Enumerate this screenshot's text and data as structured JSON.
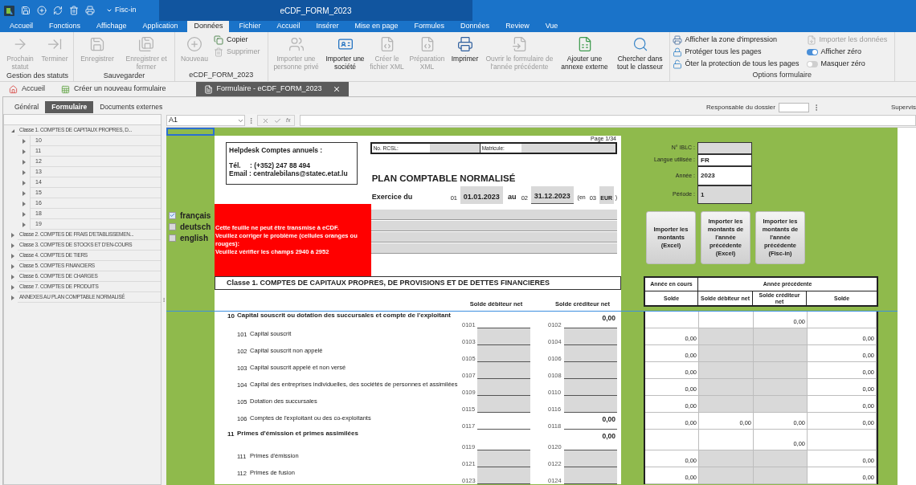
{
  "quick_access": {
    "menu_label": "Fisc-in"
  },
  "window": {
    "title": "eCDF_FORM_2023"
  },
  "ribbon_tabs": [
    {
      "label": "Accueil",
      "selected": false
    },
    {
      "label": "Fonctions",
      "selected": false
    },
    {
      "label": "Affichage",
      "selected": false
    },
    {
      "label": "Application",
      "selected": false
    },
    {
      "label": "Données",
      "selected": true
    },
    {
      "label": "Fichier",
      "selected": false
    },
    {
      "label": "Accueil",
      "selected": false
    },
    {
      "label": "Insérer",
      "selected": false
    },
    {
      "label": "Mise en page",
      "selected": false
    },
    {
      "label": "Formules",
      "selected": false
    },
    {
      "label": "Données",
      "selected": false
    },
    {
      "label": "Review",
      "selected": false
    },
    {
      "label": "Vue",
      "selected": false
    }
  ],
  "ribbon_groups": [
    {
      "label": "Gestion des statuts",
      "buttons": [
        {
          "kind": "large",
          "label": "Prochain statut",
          "disabled": true
        },
        {
          "kind": "large",
          "label": "Terminer",
          "disabled": true
        }
      ]
    },
    {
      "label": "Sauvegarder",
      "buttons": [
        {
          "kind": "large",
          "label": "Enregistrer",
          "disabled": true
        },
        {
          "kind": "large",
          "label": "Enregistrer et fermer",
          "disabled": true
        }
      ]
    },
    {
      "label": "eCDF_FORM_2023",
      "buttons": [
        {
          "kind": "large",
          "label": "Nouveau",
          "disabled": true
        },
        {
          "kind": "small",
          "label": "Copier",
          "disabled": false
        },
        {
          "kind": "small",
          "label": "Supprimer",
          "disabled": true
        }
      ]
    },
    {
      "buttons": [
        {
          "kind": "large",
          "label": "Importer une personne privé",
          "disabled": true
        },
        {
          "kind": "large",
          "label": "Importer une société",
          "disabled": false
        },
        {
          "kind": "large",
          "label": "Créer le fichier XML",
          "disabled": true
        },
        {
          "kind": "large",
          "label": "Préparation XML",
          "disabled": true
        },
        {
          "kind": "large",
          "label": "Imprimer",
          "disabled": false
        },
        {
          "kind": "large",
          "label": "Ouvrir le formulaire de l'année précédente",
          "disabled": true
        },
        {
          "kind": "large",
          "label": "Ajouter une annexe externe",
          "disabled": false
        },
        {
          "kind": "large",
          "label": "Chercher dans tout le classeur",
          "disabled": false
        }
      ]
    },
    {
      "label": "Options formulaire",
      "buttons": [
        {
          "kind": "small",
          "label": "Afficher la zone d'impression",
          "disabled": false
        },
        {
          "kind": "small",
          "label": "Protéger tous les pages",
          "disabled": false
        },
        {
          "kind": "small",
          "label": "Ôter la protection de tous les pages",
          "disabled": false
        },
        {
          "kind": "small",
          "label": "Importer les données",
          "disabled": true
        },
        {
          "kind": "toggle",
          "label": "Afficher zéro",
          "on": true
        },
        {
          "kind": "toggle",
          "label": "Masquer zéro",
          "on": false
        }
      ]
    }
  ],
  "doc_tabs": [
    {
      "label": "Accueil",
      "selected": false,
      "closable": false
    },
    {
      "label": "Créer un nouveau formulaire",
      "selected": false,
      "closable": false
    },
    {
      "label": "Formulaire - eCDF_FORM_2023",
      "selected": true,
      "closable": true
    }
  ],
  "sub_tabs": [
    {
      "label": "Général",
      "selected": false
    },
    {
      "label": "Formulaire",
      "selected": true
    },
    {
      "label": "Documents externes",
      "selected": false
    }
  ],
  "dossier": {
    "label": "Responsable du dossier",
    "next_label": "Supervis"
  },
  "tree": [
    {
      "label": "Classe 1. COMPTES DE CAPITAUX PROPRES, D...",
      "expanded": true,
      "children": [
        {
          "label": "10",
          "expanded": false
        },
        {
          "label": "11",
          "expanded": false
        },
        {
          "label": "12",
          "expanded": false
        },
        {
          "label": "13",
          "expanded": false
        },
        {
          "label": "14",
          "expanded": false
        },
        {
          "label": "15",
          "expanded": false
        },
        {
          "label": "16",
          "expanded": false
        },
        {
          "label": "18",
          "expanded": false
        },
        {
          "label": "19",
          "expanded": false
        }
      ]
    },
    {
      "label": "Classe 2. COMPTES DE FRAIS D'ETABLISSEMEN...",
      "expanded": false
    },
    {
      "label": "Classe 3. COMPTES DE STOCKS ET D'EN-COURS",
      "expanded": false
    },
    {
      "label": "Classe 4. COMPTES DE TIERS",
      "expanded": false
    },
    {
      "label": "Classe 5. COMPTES FINANCIERS",
      "expanded": false
    },
    {
      "label": "Classe 6. COMPTES DE CHARGES",
      "expanded": false
    },
    {
      "label": "Classe 7. COMPTES DE PRODUITS",
      "expanded": false
    },
    {
      "label": "ANNEXES AU PLAN COMPTABLE NORMALISÉ",
      "expanded": false
    }
  ],
  "formula_bar": {
    "cell": "A1",
    "function_label": "fx"
  },
  "languages": [
    {
      "label": "français",
      "checked": true
    },
    {
      "label": "deutsch",
      "checked": false
    },
    {
      "label": "english",
      "checked": false
    }
  ],
  "form": {
    "page_label": "Page 1/34",
    "helpdesk": {
      "title": "Helpdesk Comptes annuels :",
      "phone_label": "Tél.",
      "phone": ": (+352) 247 88 494",
      "email": "Email : centralebilans@statec.etat.lu"
    },
    "id_labels": [
      "No. RCSL:",
      "Matricule:"
    ],
    "title": "PLAN COMPTABLE NORMALISÉ",
    "exercise": {
      "label": "Exercice du",
      "start_code": "01",
      "start": "01.01.2023",
      "to": "au",
      "end_code": "02",
      "end": "31.12.2023",
      "currency_open": "(en",
      "currency_code": "03",
      "currency": "EUR",
      "currency_close": ")"
    },
    "error_lines": [
      "Cette feuille ne peut être transmise à eCDF.",
      "Veuillez corriger le problème (cellules oranges ou rouges):",
      "Veuillez vérifier les champs 2940 à 2952"
    ],
    "blank_rows": [
      {
        "input": true
      },
      {
        "input": true
      },
      {
        "input": true
      },
      {
        "input": true
      }
    ],
    "section_title": "Classe 1. COMPTES DE CAPITAUX PROPRES, DE PROVISIONS ET DE DETTES FINANCIERES",
    "columns": [
      "Solde débiteur net",
      "Solde créditeur net"
    ]
  },
  "info_fields": [
    {
      "label": "N° IBLC :",
      "input": true
    },
    {
      "label": "Langue utilisée :",
      "value": "FR",
      "input": false
    },
    {
      "label": "Année :",
      "value": "2023",
      "input": false
    },
    {
      "label": "Période :",
      "value": "1",
      "input": true
    }
  ],
  "import_buttons": [
    "Importer les montants (Excel)",
    "Importer les montants de l'année précédente (Excel)",
    "Importer les montants de l'année précédente (Fisc-in)"
  ],
  "table_header": {
    "current": "Année en cours",
    "previous": "Année précédente",
    "columns": [
      "Solde",
      "Solde débiteur net",
      "Solde créditeur net",
      "Solde"
    ]
  },
  "rows": [
    {
      "kind": "group",
      "number": "10",
      "label": "Capital souscrit ou dotation des succursales et compte de l'exploitant",
      "debit": {
        "code": "0101",
        "input": false
      },
      "credit": {
        "code": "0102",
        "value": "0,00",
        "input": false
      },
      "table": [
        {
          "input": false
        },
        {
          "input": false
        },
        {
          "value": "0,00",
          "input": false
        },
        {
          "input": false
        }
      ]
    },
    {
      "kind": "account",
      "number": "101",
      "label": "Capital souscrit",
      "debit": {
        "code": "0103",
        "input": true
      },
      "credit": {
        "code": "0104",
        "input": true
      },
      "table": [
        {
          "value": "0,00",
          "input": false
        },
        {
          "input": true
        },
        {
          "input": true
        },
        {
          "value": "0,00",
          "input": false
        }
      ]
    },
    {
      "kind": "account",
      "number": "102",
      "label": "Capital souscrit non appelé",
      "debit": {
        "code": "0105",
        "input": true
      },
      "credit": {
        "code": "0106",
        "input": true
      },
      "table": [
        {
          "value": "0,00",
          "input": false
        },
        {
          "input": true
        },
        {
          "input": true
        },
        {
          "value": "0,00",
          "input": false
        }
      ]
    },
    {
      "kind": "account",
      "number": "103",
      "label": "Capital souscrit appelé et non versé",
      "debit": {
        "code": "0107",
        "input": true
      },
      "credit": {
        "code": "0108",
        "input": true
      },
      "table": [
        {
          "value": "0,00",
          "input": false
        },
        {
          "input": true
        },
        {
          "input": true
        },
        {
          "value": "0,00",
          "input": false
        }
      ]
    },
    {
      "kind": "account",
      "number": "104",
      "label": "Capital des entreprises individuelles, des sociétés de personnes et assimilées",
      "debit": {
        "code": "0109",
        "input": true
      },
      "credit": {
        "code": "0110",
        "input": true
      },
      "table": [
        {
          "value": "0,00",
          "input": false
        },
        {
          "input": true
        },
        {
          "input": true
        },
        {
          "value": "0,00",
          "input": false
        }
      ]
    },
    {
      "kind": "account",
      "number": "105",
      "label": "Dotation des succursales",
      "debit": {
        "code": "0115",
        "input": true
      },
      "credit": {
        "code": "0116",
        "input": true
      },
      "table": [
        {
          "value": "0,00",
          "input": false
        },
        {
          "input": true
        },
        {
          "input": true
        },
        {
          "value": "0,00",
          "input": false
        }
      ]
    },
    {
      "kind": "account",
      "number": "106",
      "label": "Comptes de l'exploitant ou des co-exploitants",
      "debit": {
        "code": "0117",
        "input": false
      },
      "credit": {
        "code": "0118",
        "value": "0,00",
        "input": false
      },
      "table": [
        {
          "value": "0,00",
          "input": false
        },
        {
          "value": "0,00",
          "input": false
        },
        {
          "value": "0,00",
          "input": false
        },
        {
          "value": "0,00",
          "input": false
        }
      ]
    },
    {
      "kind": "group",
      "number": "11",
      "label": "Primes d'émission et primes assimilées",
      "debit": {
        "code": "0119",
        "input": false
      },
      "credit": {
        "code": "0120",
        "value": "0,00",
        "input": false
      },
      "table": [
        {
          "input": false
        },
        {
          "input": false
        },
        {
          "value": "0,00",
          "input": false
        },
        {
          "input": false
        }
      ]
    },
    {
      "kind": "account",
      "number": "111",
      "label": "Primes d'émission",
      "debit": {
        "code": "0121",
        "input": true
      },
      "credit": {
        "code": "0122",
        "input": true
      },
      "table": [
        {
          "value": "0,00",
          "input": false
        },
        {
          "input": true
        },
        {
          "input": true
        },
        {
          "value": "0,00",
          "input": false
        }
      ]
    },
    {
      "kind": "account",
      "number": "112",
      "label": "Primes de fusion",
      "debit": {
        "code": "0123",
        "input": true
      },
      "credit": {
        "code": "0124",
        "input": true
      },
      "table": [
        {
          "value": "0,00",
          "input": false
        },
        {
          "input": true
        },
        {
          "input": true
        },
        {
          "value": "0,00",
          "input": false
        }
      ]
    }
  ]
}
